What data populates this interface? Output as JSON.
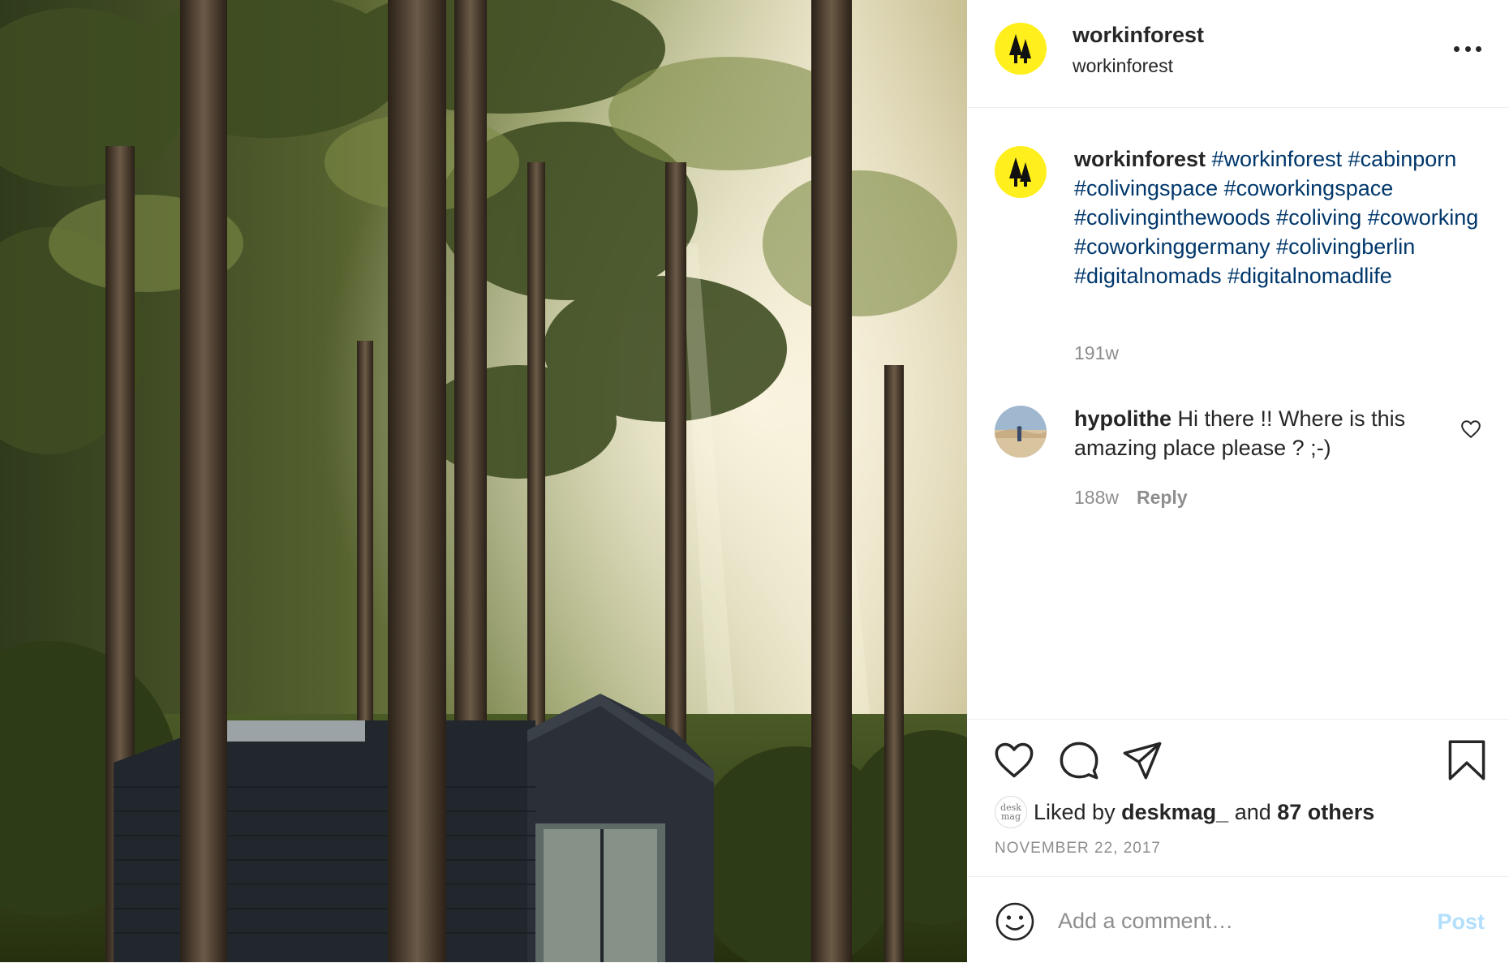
{
  "photo": {
    "alt_icon": "forest-cabin-photo"
  },
  "header": {
    "username": "workinforest",
    "subtitle": "workinforest",
    "brand_color": "#ffef1d",
    "more_icon": "more-horizontal-icon"
  },
  "caption": {
    "username": "workinforest",
    "tags": [
      "#workinforest",
      "#cabinporn",
      "#colivingspace",
      "#coworkingspace",
      "#colivinginthewoods",
      "#coliving",
      "#coworking",
      "#coworkinggermany",
      "#colivingberlin",
      "#digitalnomads",
      "#digitalnomadlife"
    ],
    "age": "191w"
  },
  "comment": {
    "username": "hypolithe",
    "text": "Hi there !! Where is this amazing place please ? ;-)",
    "age": "188w",
    "reply_label": "Reply"
  },
  "actions": {
    "icons": [
      "heart-icon",
      "comment-icon",
      "share-icon",
      "bookmark-icon"
    ],
    "liked_by_prefix": "Liked by",
    "liked_by_user": "deskmag_",
    "liked_by_mid": "and",
    "liked_by_others": "87 others",
    "liker_avatar_line1": "desk",
    "liker_avatar_line2": "mag",
    "date": "NOVEMBER 22, 2017"
  },
  "add_comment": {
    "placeholder": "Add a comment…",
    "post_label": "Post",
    "post_color": "#b2dffc"
  }
}
